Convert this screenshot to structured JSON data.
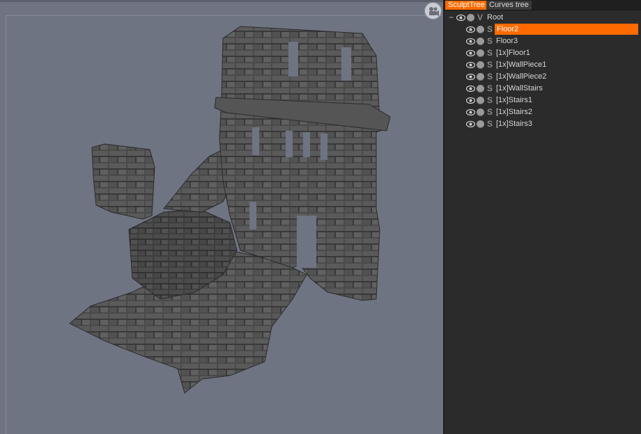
{
  "viewport": {
    "background": "#6f7483",
    "camera_icon": "camera-icon"
  },
  "panel": {
    "tabs": [
      {
        "label": "SculptTree",
        "active": true
      },
      {
        "label": "Curves  tree",
        "active": false
      }
    ],
    "accent": "#ff6a00",
    "tree": {
      "root": {
        "label": "Root",
        "mode": "V",
        "collapse_symbol": "−"
      },
      "items": [
        {
          "label": "Floor2",
          "mode": "S",
          "selected": true
        },
        {
          "label": "Floor3",
          "mode": "S",
          "selected": false
        },
        {
          "label": "[1x]Floor1",
          "mode": "S",
          "selected": false
        },
        {
          "label": "[1x]WallPiece1",
          "mode": "S",
          "selected": false
        },
        {
          "label": "[1x]WallPiece2",
          "mode": "S",
          "selected": false
        },
        {
          "label": "[1x]WallStairs",
          "mode": "S",
          "selected": false
        },
        {
          "label": "[1x]Stairs1",
          "mode": "S",
          "selected": false
        },
        {
          "label": "[1x]Stairs2",
          "mode": "S",
          "selected": false
        },
        {
          "label": "[1x]Stairs3",
          "mode": "S",
          "selected": false
        }
      ]
    }
  }
}
